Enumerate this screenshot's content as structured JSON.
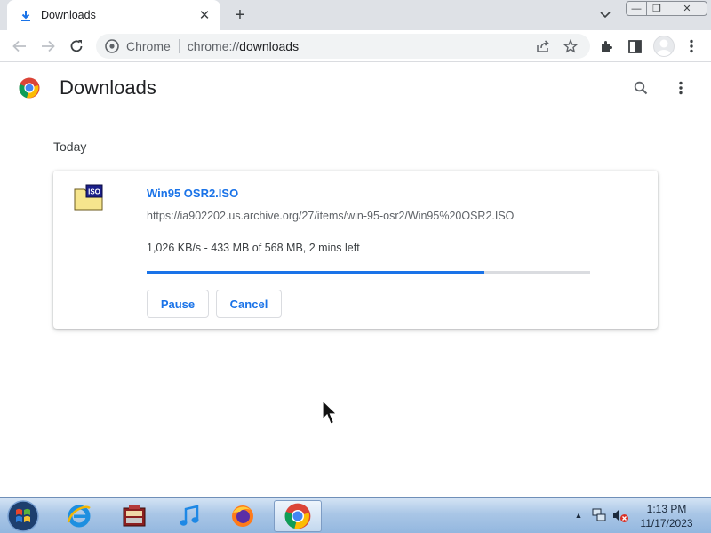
{
  "tab": {
    "title": "Downloads",
    "icon": "download-arrow-icon",
    "close": "✕"
  },
  "new_tab": "+",
  "window_controls": {
    "minimize": "—",
    "maximize": "❐",
    "close": "✕"
  },
  "toolbar": {
    "scheme_label": "Chrome",
    "url_prefix": "chrome://",
    "url_path": "downloads"
  },
  "page": {
    "title": "Downloads"
  },
  "downloads": {
    "date_group": "Today",
    "item": {
      "file_name": "Win95 OSR2.ISO",
      "url": "https://ia902202.us.archive.org/27/items/win-95-osr2/Win95%20OSR2.ISO",
      "status": "1,026 KB/s - 433 MB of 568 MB, 2 mins left",
      "progress": 0.762,
      "pause_label": "Pause",
      "cancel_label": "Cancel",
      "icon_badge": "ISO"
    }
  },
  "taskbar": {
    "apps": [
      "internet-explorer-icon",
      "media-center-icon",
      "itunes-icon",
      "firefox-icon",
      "chrome-icon"
    ],
    "clock_time": "1:13 PM",
    "clock_date": "11/17/2023"
  },
  "colors": {
    "accent": "#1a73e8",
    "progress_track": "#dadce0",
    "tabstrip": "#dee1e6"
  }
}
